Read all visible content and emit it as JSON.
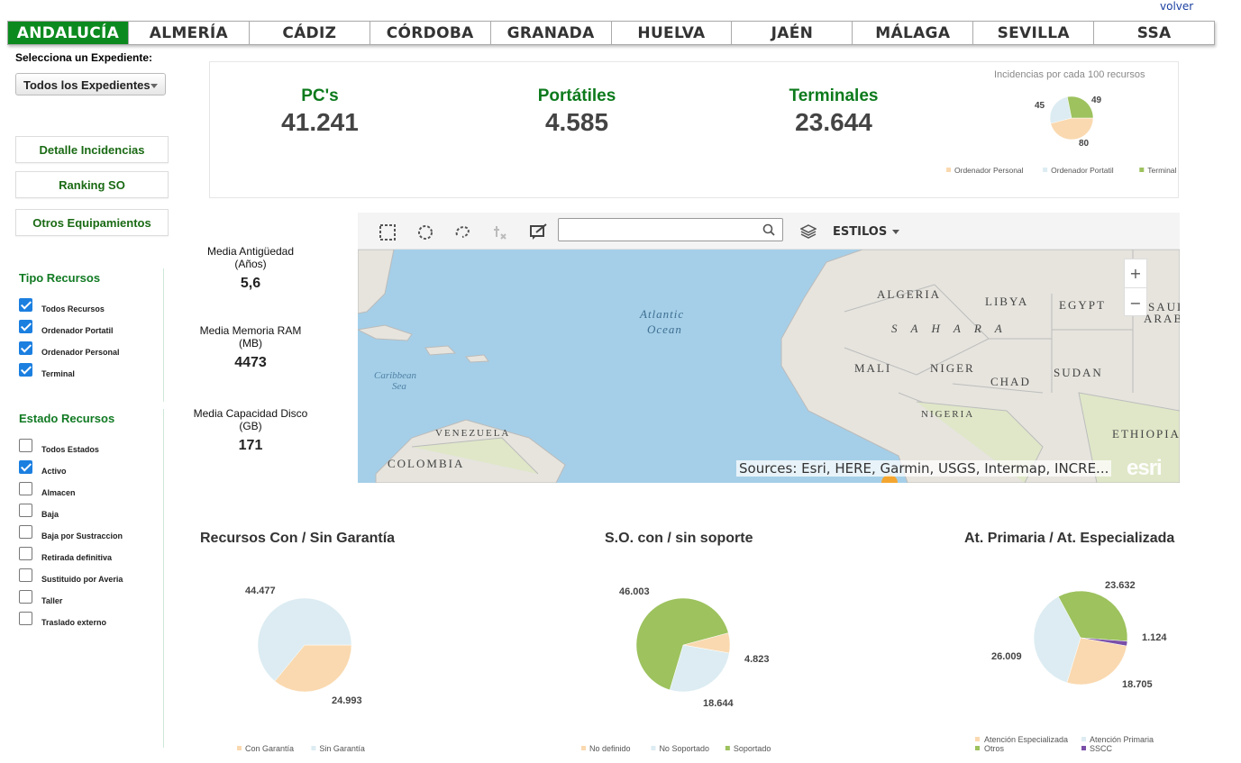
{
  "header": {
    "volver": "volver",
    "tabs": [
      "ANDALUCÍA",
      "ALMERÍA",
      "CÁDIZ",
      "CÓRDOBA",
      "GRANADA",
      "HUELVA",
      "JAÉN",
      "MÁLAGA",
      "SEVILLA",
      "SSA"
    ],
    "active_tab": "ANDALUCÍA"
  },
  "sidebar": {
    "expediente_label": "Selecciona un Expediente:",
    "expediente_value": "Todos los Expedientes",
    "buttons": [
      "Detalle Incidencias",
      "Ranking SO",
      "Otros Equipamientos"
    ],
    "tipo_title": "Tipo Recursos",
    "tipo_items": [
      {
        "label": "Todos Recursos",
        "checked": true
      },
      {
        "label": "Ordenador Portatil",
        "checked": true
      },
      {
        "label": "Ordenador Personal",
        "checked": true
      },
      {
        "label": "Terminal",
        "checked": true
      }
    ],
    "estado_title": "Estado Recursos",
    "estado_items": [
      {
        "label": "Todos Estados",
        "checked": false
      },
      {
        "label": "Activo",
        "checked": true
      },
      {
        "label": "Almacen",
        "checked": false
      },
      {
        "label": "Baja",
        "checked": false
      },
      {
        "label": "Baja por Sustraccion",
        "checked": false
      },
      {
        "label": "Retirada definitiva",
        "checked": false
      },
      {
        "label": "Sustituido por Averia",
        "checked": false
      },
      {
        "label": "Taller",
        "checked": false
      },
      {
        "label": "Traslado externo",
        "checked": false
      }
    ]
  },
  "stats": {
    "pcs_label": "PC's",
    "pcs_value": "41.241",
    "portatiles_label": "Portátiles",
    "portatiles_value": "4.585",
    "terminales_label": "Terminales",
    "terminales_value": "23.644"
  },
  "averages": {
    "antiguedad_label": "Media Antigüedad",
    "antiguedad_unit": "(Años)",
    "antiguedad_value": "5,6",
    "ram_label": "Media Memoria RAM",
    "ram_unit": "(MB)",
    "ram_value": "4473",
    "disco_label": "Media Capacidad Disco",
    "disco_unit": "(GB)",
    "disco_value": "171"
  },
  "map": {
    "estilos": "ESTILOS",
    "search_placeholder": "",
    "attribution": "Sources: Esri, HERE, Garmin, USGS, Intermap, INCRE...",
    "logo": "esri",
    "zoom_in": "+",
    "zoom_out": "−",
    "labels": [
      "ALGERIA",
      "LIBYA",
      "EGYPT",
      "SAUD",
      "ARAB",
      "S A H A R A",
      "MALI",
      "NIGER",
      "CHAD",
      "SUDAN",
      "NIGERIA",
      "ETHIOPIA",
      "VENEZUELA",
      "COLOMBIA",
      "Atlantic",
      "Ocean",
      "Caribbean",
      "Sea"
    ],
    "icons": [
      "select-rectangle-icon",
      "select-circle-icon",
      "select-lasso-icon",
      "clear-selection-icon",
      "edit-icon",
      "search-icon",
      "layers-icon",
      "caret-down-icon"
    ]
  },
  "colors": {
    "accent_green": "#0c8a1f",
    "title_green": "#0c7a1c",
    "pie_peach": "#fad9b0",
    "pie_lightblue": "#dcecf2",
    "pie_green": "#9dc25e",
    "pie_darkgreen": "#4c6a28",
    "pie_purple": "#7a4fa8"
  },
  "chart_data": [
    {
      "type": "pie",
      "title": "Incidencias por cada 100 recursos",
      "categories": [
        "Ordenador Personal",
        "Ordenador Portatil",
        "Terminal"
      ],
      "values": [
        80,
        45,
        49
      ],
      "legend": [
        "Ordenador Personal",
        "Ordenador Portatil",
        "Terminal"
      ]
    },
    {
      "type": "pie",
      "title": "Recursos Con / Sin Garantía",
      "categories": [
        "Con Garantía",
        "Sin Garantía"
      ],
      "values": [
        24993,
        44477
      ],
      "labels": [
        "24.993",
        "44.477"
      ]
    },
    {
      "type": "pie",
      "title": "S.O. con / sin soporte",
      "categories": [
        "No definido",
        "No Soportado",
        "Soportado"
      ],
      "values": [
        4823,
        18644,
        46003
      ],
      "labels": [
        "4.823",
        "18.644",
        "46.003"
      ]
    },
    {
      "type": "pie",
      "title": "At. Primaria / At. Especializada",
      "categories": [
        "Atención Especializada",
        "Atención Primaria",
        "Otros",
        "SSCC"
      ],
      "values": [
        18705,
        26009,
        23632,
        1124
      ],
      "labels": [
        "18.705",
        "26.009",
        "23.632",
        "1.124"
      ]
    }
  ]
}
